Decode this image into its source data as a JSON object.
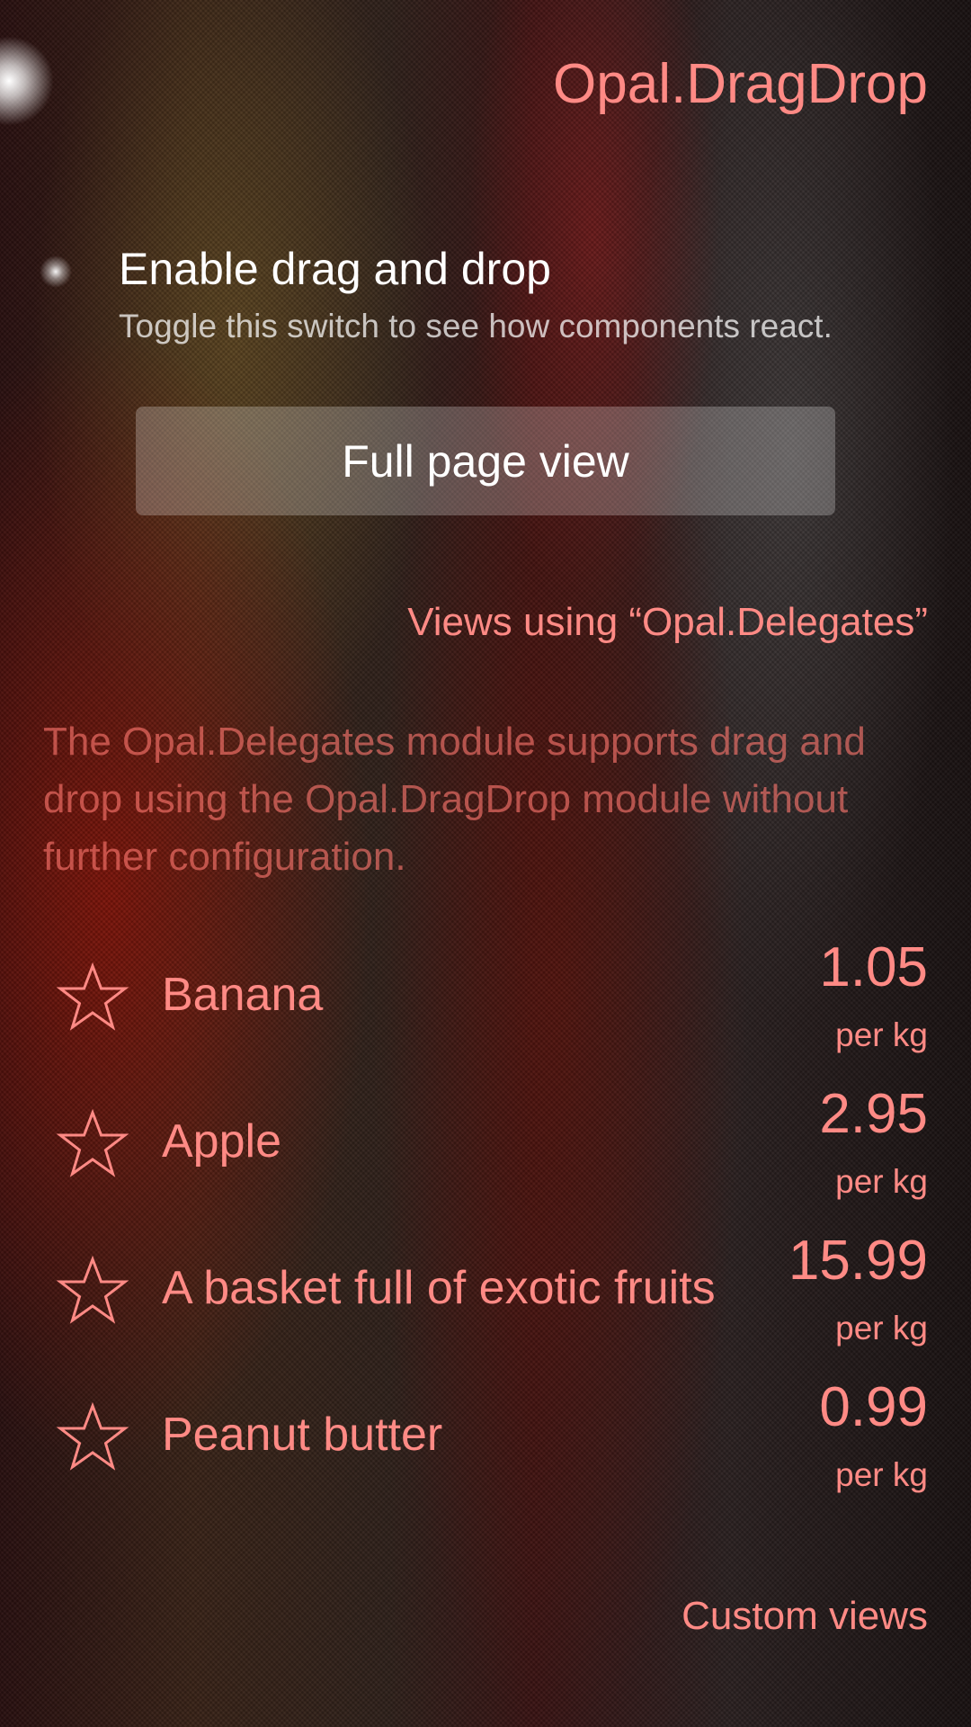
{
  "page": {
    "title": "Opal.DragDrop"
  },
  "toggle": {
    "label": "Enable drag and drop",
    "description": "Toggle this switch to see how components react.",
    "checked": false
  },
  "button": {
    "label": "Full page view"
  },
  "section1": {
    "header": "Views using “Opal.Delegates”",
    "paragraph": "The Opal.Delegates module supports drag and drop using the Opal.DragDrop module without further configuration."
  },
  "items": [
    {
      "name": "Banana",
      "price": "1.05",
      "unit": "per kg",
      "icon": "star-icon"
    },
    {
      "name": "Apple",
      "price": "2.95",
      "unit": "per kg",
      "icon": "star-icon"
    },
    {
      "name": "A basket full of exotic fruits",
      "price": "15.99",
      "unit": "per kg",
      "icon": "star-icon"
    },
    {
      "name": "Peanut butter",
      "price": "0.99",
      "unit": "per kg",
      "icon": "star-icon"
    }
  ],
  "section2": {
    "header": "Custom views"
  },
  "colors": {
    "highlight": "#ff8a85",
    "primary": "#ffffff"
  }
}
